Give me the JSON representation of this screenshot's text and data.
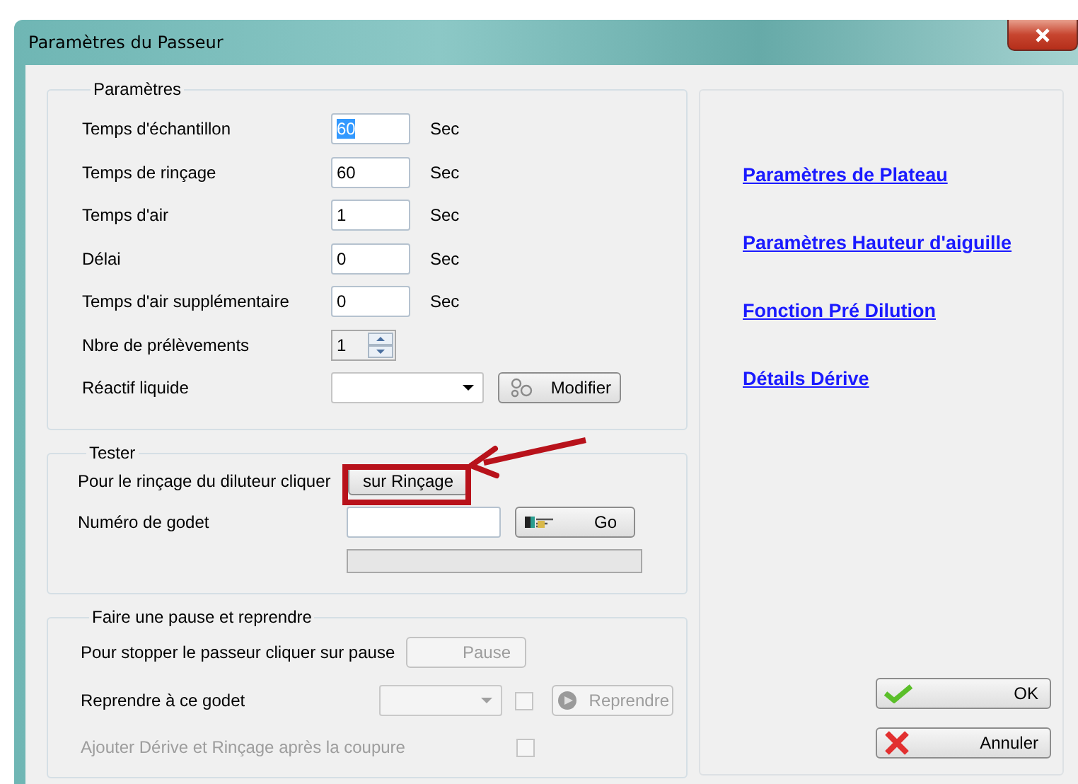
{
  "window": {
    "title": "Paramètres du Passeur"
  },
  "parameters": {
    "title": "Paramètres",
    "rows": [
      {
        "kind": "text",
        "label": "Temps d'échantillon",
        "value": "60",
        "selected": true,
        "unit": "Sec"
      },
      {
        "kind": "text",
        "label": "Temps de rinçage",
        "value": "60",
        "selected": false,
        "unit": "Sec"
      },
      {
        "kind": "text",
        "label": "Temps d'air",
        "value": "1",
        "selected": false,
        "unit": "Sec"
      },
      {
        "kind": "text",
        "label": "Délai",
        "value": "0",
        "selected": false,
        "unit": "Sec"
      },
      {
        "kind": "text",
        "label": "Temps d'air supplémentaire",
        "value": "0",
        "selected": false,
        "unit": "Sec"
      },
      {
        "kind": "spin",
        "label": "Nbre de prélèvements",
        "value": "1"
      },
      {
        "kind": "combo",
        "label": "Réactif liquide",
        "button": "Modifier"
      }
    ]
  },
  "tester": {
    "title": "Tester",
    "rinse_label": "Pour le rinçage du diluteur  cliquer",
    "rinse_button": "sur Rinçage",
    "cup_label": "Numéro de godet",
    "go_button": "Go",
    "progress": {
      "level": 0
    }
  },
  "pause": {
    "title": "Faire une pause et reprendre",
    "stop_label": "Pour stopper le passeur cliquer sur pause",
    "pause_button": {
      "label": "Pause",
      "disabled": true
    },
    "resume_label": "Reprendre à ce godet",
    "resume_combo": {
      "disabled": true
    },
    "resume_check": {
      "checked": false,
      "disabled": true
    },
    "resume_button": {
      "label": "Reprendre",
      "disabled": true
    },
    "add_option": {
      "label": "Ajouter Dérive et Rinçage après la coupure",
      "checked": false,
      "disabled": true
    }
  },
  "links": [
    "Paramètres de Plateau",
    "Paramètres Hauteur d'aiguille",
    "Fonction Pré Dilution",
    "Détails Dérive"
  ],
  "buttons": [
    {
      "kind": "ok",
      "label": "OK"
    },
    {
      "kind": "cancel",
      "label": "Annuler"
    }
  ]
}
